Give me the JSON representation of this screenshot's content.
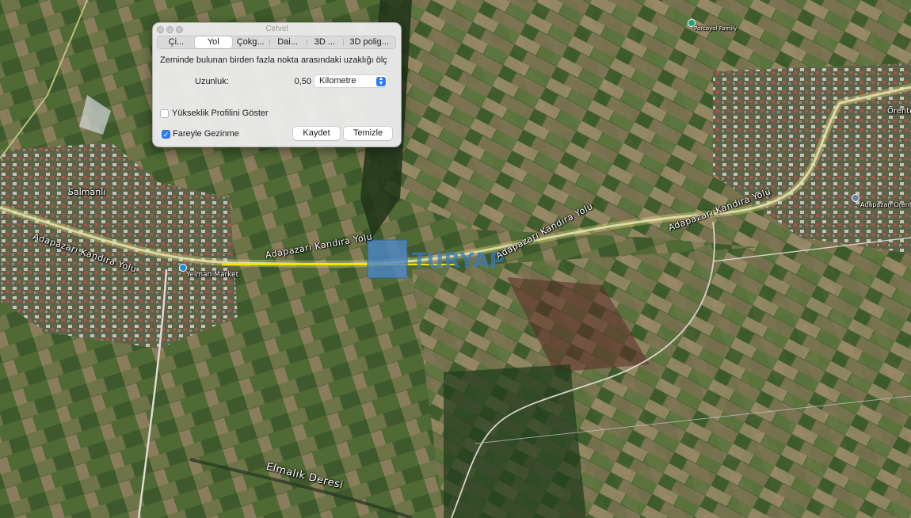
{
  "ruler": {
    "title": "Cetvel",
    "tabs": [
      "Çi...",
      "Yol",
      "Çokg...",
      "Dai...",
      "3D ...",
      "3D polig..."
    ],
    "active_tab": 1,
    "description": "Zeminde bulunan birden fazla nokta arasındaki uzaklığı ölç",
    "length_label": "Uzunluk:",
    "length_value": "0,50",
    "unit": "Kilometre",
    "elevation_profile_label": "Yükseklik Profilini Göster",
    "elevation_profile_checked": false,
    "mouse_nav_label": "Fareyle Gezinme",
    "mouse_nav_checked": true,
    "save_label": "Kaydet",
    "clear_label": "Temizle"
  },
  "map": {
    "road_labels": [
      "Adapazarı Kandıra Yolu",
      "Adapazarı Kandıra Yolu",
      "Adapazarı Kandıra Yolu",
      "Adapazarı Kandıra Yolu"
    ],
    "places": {
      "salmanli": "Salmanlı",
      "yelman": "Yelman Market",
      "porcoyol": "Porcoyol Family",
      "orentepe": "Örente",
      "adapazari_orente": "Adapazarı Örente",
      "elmalik": "Elmalık Deresi"
    },
    "watermark": "TURYAP",
    "colors": {
      "measure_line": "#f2e600",
      "poi_blue": "#1a8fd8",
      "poi_green": "#1aa37a",
      "accent": "#2e7cf6"
    }
  }
}
